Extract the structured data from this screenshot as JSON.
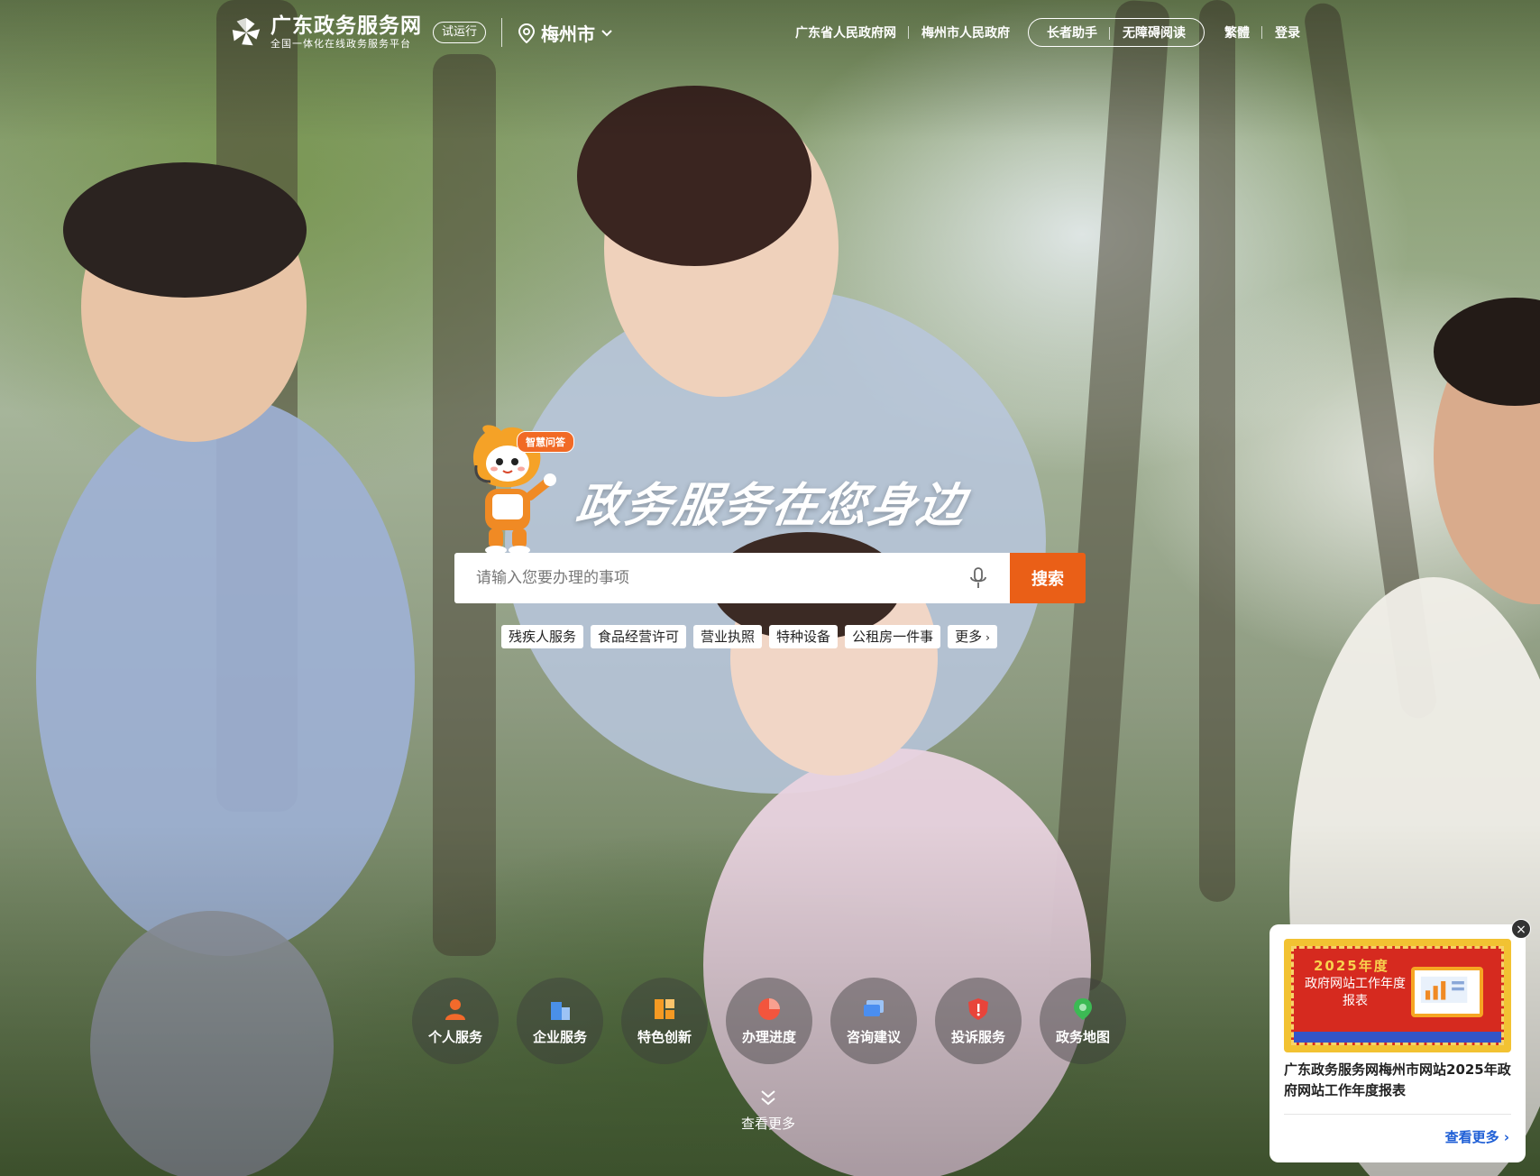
{
  "site": {
    "name": "广东政务服务网",
    "tagline": "全国一体化在线政务服务平台",
    "trial_badge": "试运行",
    "city": "梅州市"
  },
  "nav": {
    "links": [
      "广东省人民政府网",
      "梅州市人民政府"
    ],
    "assist": [
      "长者助手",
      "无障碍阅读"
    ],
    "traditional": "繁體",
    "login": "登录"
  },
  "hero": {
    "mascot_bubble": "智慧问答",
    "slogan": "政务服务在您身边"
  },
  "search": {
    "placeholder": "请输入您要办理的事项",
    "button": "搜索"
  },
  "tags": [
    "残疾人服务",
    "食品经营许可",
    "营业执照",
    "特种设备",
    "公租房一件事",
    "更多"
  ],
  "services": [
    {
      "label": "个人服务",
      "icon": "person-icon",
      "color": "#f36a2b"
    },
    {
      "label": "企业服务",
      "icon": "building-icon",
      "color": "#4a90e8"
    },
    {
      "label": "特色创新",
      "icon": "grid-icon",
      "color": "#f59a23"
    },
    {
      "label": "办理进度",
      "icon": "pie-progress-icon",
      "color": "#f2553d"
    },
    {
      "label": "咨询建议",
      "icon": "chat-icon",
      "color": "#4a8ef0"
    },
    {
      "label": "投诉服务",
      "icon": "shield-alert-icon",
      "color": "#e8443a"
    },
    {
      "label": "政务地图",
      "icon": "map-pin-icon",
      "color": "#3cba54"
    }
  ],
  "more_label": "查看更多",
  "popup": {
    "stamp_year": "2025年度",
    "stamp_title": "政府网站工作年度报表",
    "title": "广东政务服务网梅州市网站2025年政府网站工作年度报表",
    "more": "查看更多",
    "close": "×"
  },
  "colors": {
    "accent": "#ea5f17",
    "link": "#1f5fd6"
  }
}
